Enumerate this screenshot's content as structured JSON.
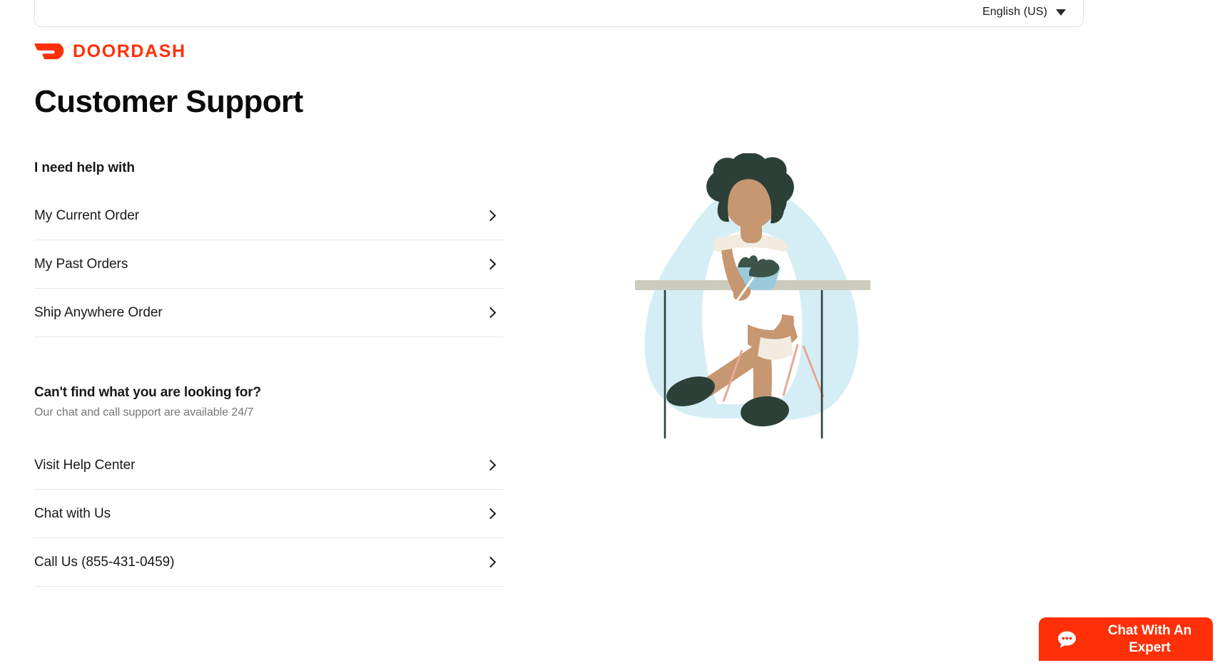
{
  "brand": {
    "name": "DOORDASH",
    "logo_icon": "doordash-swoosh-icon",
    "accent_color": "#ff3008"
  },
  "header": {
    "language": {
      "selected": "English (US)",
      "chevron_icon": "chevron-down-icon"
    }
  },
  "page": {
    "title": "Customer Support"
  },
  "help_section": {
    "heading": "I need help with",
    "items": [
      {
        "label": "My Current Order",
        "chevron_icon": "chevron-right-icon"
      },
      {
        "label": "My Past Orders",
        "chevron_icon": "chevron-right-icon"
      },
      {
        "label": "Ship Anywhere Order",
        "chevron_icon": "chevron-right-icon"
      }
    ]
  },
  "contact_section": {
    "heading": "Can't find what you are looking for?",
    "subtitle": "Our chat and call support are available 24/7",
    "items": [
      {
        "label": "Visit Help Center",
        "chevron_icon": "chevron-right-icon"
      },
      {
        "label": "Chat with Us",
        "chevron_icon": "chevron-right-icon"
      },
      {
        "label": "Call Us (855-431-0459)",
        "chevron_icon": "chevron-right-icon"
      }
    ]
  },
  "chat_fab": {
    "label": "Chat With An Expert",
    "icon": "chat-bubble-icon",
    "background_color": "#ff3008"
  },
  "illustration": {
    "name": "woman-eating-salad-at-table-illustration",
    "colors": {
      "blob": "#d5eef5",
      "hair": "#2c4038",
      "skin": "#c79772",
      "dress": "#ffffff",
      "bowl": "#9cc9dd",
      "greens": "#3c5447",
      "table": "#cdcbbd",
      "shoes": "#2c4038",
      "stool_legs": "#e8a894"
    }
  }
}
